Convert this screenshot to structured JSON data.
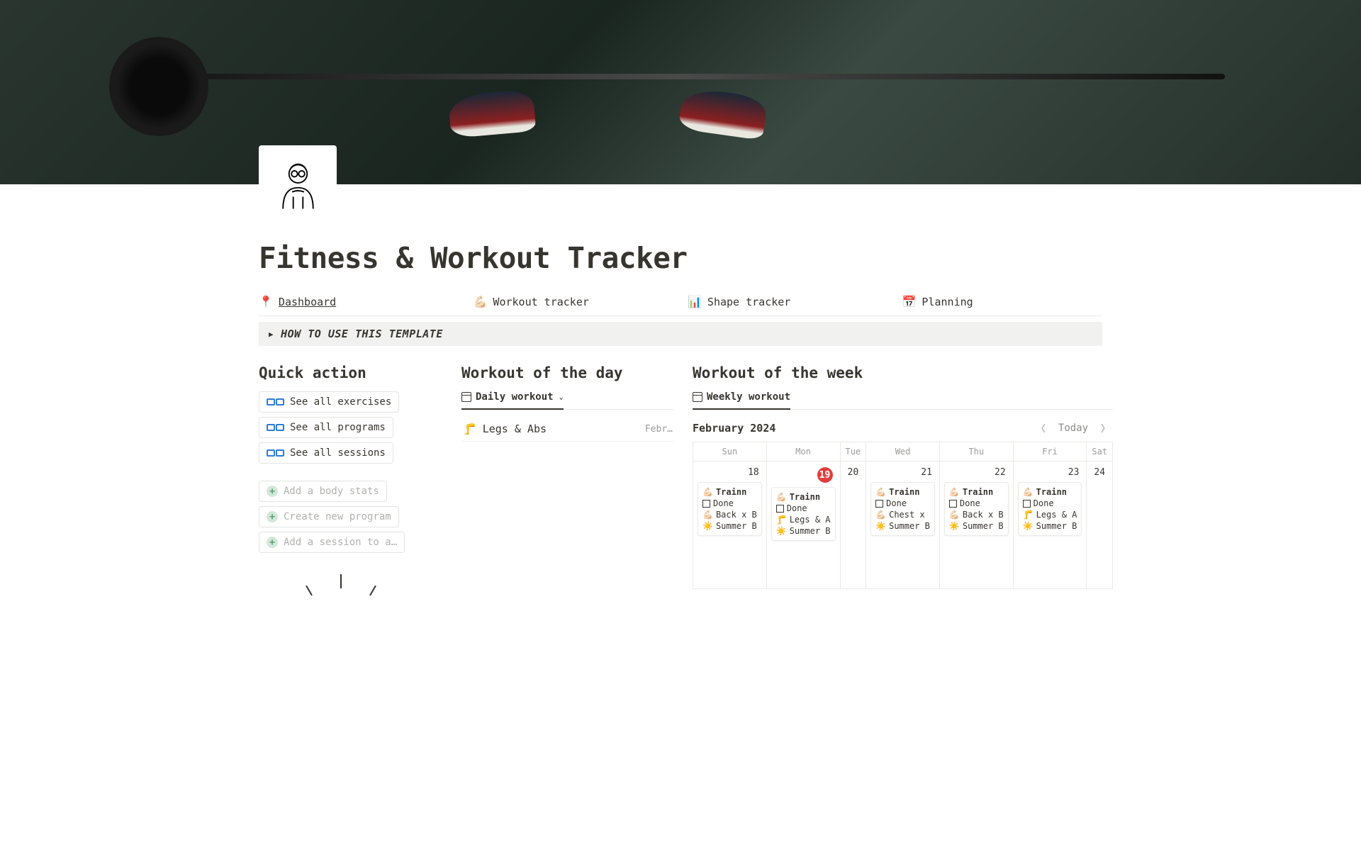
{
  "page": {
    "title": "Fitness & Workout Tracker"
  },
  "nav": [
    {
      "icon": "📍",
      "label": "Dashboard",
      "active": true
    },
    {
      "icon": "💪🏻",
      "label": "Workout tracker",
      "active": false
    },
    {
      "icon": "📊",
      "label": "Shape tracker",
      "active": false
    },
    {
      "icon": "📅",
      "label": "Planning",
      "active": false
    }
  ],
  "callout": {
    "text": "HOW TO USE THIS TEMPLATE"
  },
  "quick_action": {
    "heading": "Quick action",
    "links": [
      {
        "label": "See all exercises"
      },
      {
        "label": "See all programs"
      },
      {
        "label": "See all sessions"
      }
    ],
    "creates": [
      {
        "label": "Add a body stats"
      },
      {
        "label": "Create new program"
      },
      {
        "label": "Add a session to a…"
      }
    ]
  },
  "workout_day": {
    "heading": "Workout of the day",
    "view_label": "Daily workout",
    "item": {
      "icon": "🦵",
      "title": "Legs & Abs",
      "date": "Febr…"
    }
  },
  "workout_week": {
    "heading": "Workout of the week",
    "view_label": "Weekly workout",
    "month": "February 2024",
    "today_label": "Today",
    "dow": [
      "Sun",
      "Mon",
      "Tue",
      "Wed",
      "Thu",
      "Fri",
      "Sat"
    ],
    "days": [
      {
        "num": "18",
        "today": false,
        "event": {
          "title": "Trainn",
          "done_label": "Done",
          "detail_icon": "💪🏻",
          "detail": "Back x B",
          "program": "Summer B"
        }
      },
      {
        "num": "19",
        "today": true,
        "event": {
          "title": "Trainn",
          "done_label": "Done",
          "detail_icon": "🦵",
          "detail": "Legs & A",
          "program": "Summer B"
        }
      },
      {
        "num": "20",
        "today": false,
        "event": null
      },
      {
        "num": "21",
        "today": false,
        "event": {
          "title": "Trainn",
          "done_label": "Done",
          "detail_icon": "💪🏻",
          "detail": "Chest x",
          "program": "Summer B"
        }
      },
      {
        "num": "22",
        "today": false,
        "event": {
          "title": "Trainn",
          "done_label": "Done",
          "detail_icon": "💪🏻",
          "detail": "Back x B",
          "program": "Summer B"
        }
      },
      {
        "num": "23",
        "today": false,
        "event": {
          "title": "Trainn",
          "done_label": "Done",
          "detail_icon": "🦵",
          "detail": "Legs & A",
          "program": "Summer B"
        }
      },
      {
        "num": "24",
        "today": false,
        "event": null
      }
    ]
  }
}
